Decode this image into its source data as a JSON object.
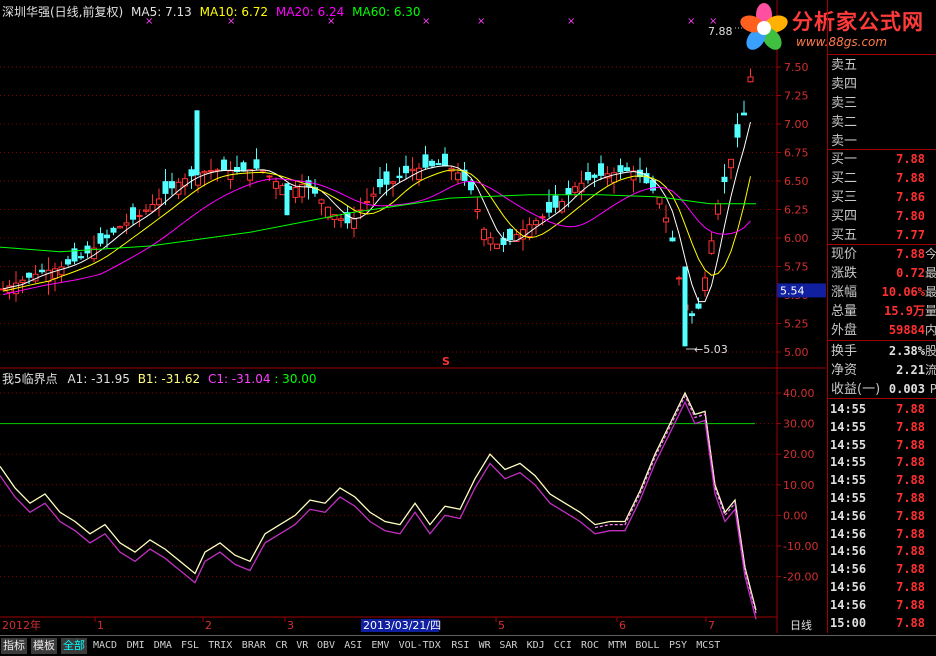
{
  "header": {
    "stock": "深圳华强(日线,前复权)",
    "ma5": "MA5: 7.13",
    "ma10": "MA10: 6.72",
    "ma20": "MA20: 6.24",
    "ma60": "MA60: 6.30"
  },
  "indicator": {
    "name": "我5临界点",
    "a1": "A1: -31.95",
    "b1": "B1: -31.62",
    "c1": "C1: -31.04",
    "level": ": 30.00"
  },
  "price_axis": [
    "7.50",
    "7.25",
    "7.00",
    "6.75",
    "6.50",
    "6.25",
    "6.00",
    "5.75",
    "5.50",
    "5.25",
    "5.00"
  ],
  "price_highlight": "5.54",
  "high_label": "7.88",
  "low_label": "←5.03",
  "ind_axis": [
    "40.00",
    "30.00",
    "20.00",
    "10.00",
    "0.00",
    "-10.00",
    "-20.00"
  ],
  "date_axis": {
    "year": "2012年",
    "ticks": [
      "1",
      "2",
      "3",
      "5",
      "6",
      "7"
    ],
    "selected": "2013/03/21/四",
    "period": "日线"
  },
  "s_marker": "S",
  "logo": {
    "title": "分析家公式网",
    "url": "www.88gs.com"
  },
  "quote": {
    "asks": [
      {
        "label": "卖五",
        "price": "",
        "vol": ""
      },
      {
        "label": "卖四",
        "price": "",
        "vol": ""
      },
      {
        "label": "卖三",
        "price": "",
        "vol": ""
      },
      {
        "label": "卖二",
        "price": "",
        "vol": ""
      },
      {
        "label": "卖一",
        "price": "",
        "vol": ""
      }
    ],
    "bids": [
      {
        "label": "买一",
        "price": "7.88"
      },
      {
        "label": "买二",
        "price": "7.88"
      },
      {
        "label": "买三",
        "price": "7.86"
      },
      {
        "label": "买四",
        "price": "7.80"
      },
      {
        "label": "买五",
        "price": "7.77"
      }
    ],
    "stats": [
      {
        "label": "现价",
        "value": "7.88",
        "ext": "今"
      },
      {
        "label": "涨跌",
        "value": "0.72",
        "ext": "最"
      },
      {
        "label": "涨幅",
        "value": "10.06%",
        "ext": "最"
      },
      {
        "label": "总量",
        "value": "15.9万",
        "ext": "量"
      },
      {
        "label": "外盘",
        "value": "59884",
        "ext": "内"
      }
    ],
    "stats2": [
      {
        "label": "换手",
        "value": "2.38%",
        "ext": "股"
      },
      {
        "label": "净资",
        "value": "2.21",
        "ext": "流"
      },
      {
        "label": "收益(一)",
        "value": "0.003",
        "ext": "P"
      }
    ],
    "ticks": [
      {
        "time": "14:55",
        "price": "7.88"
      },
      {
        "time": "14:55",
        "price": "7.88"
      },
      {
        "time": "14:55",
        "price": "7.88"
      },
      {
        "time": "14:55",
        "price": "7.88"
      },
      {
        "time": "14:55",
        "price": "7.88"
      },
      {
        "time": "14:55",
        "price": "7.88"
      },
      {
        "time": "14:56",
        "price": "7.88"
      },
      {
        "time": "14:56",
        "price": "7.88"
      },
      {
        "time": "14:56",
        "price": "7.88"
      },
      {
        "time": "14:56",
        "price": "7.88"
      },
      {
        "time": "14:56",
        "price": "7.88"
      },
      {
        "time": "14:56",
        "price": "7.88"
      },
      {
        "time": "15:00",
        "price": "7.88"
      }
    ]
  },
  "tabs": {
    "buttons": [
      "指标",
      "模板",
      "全部"
    ],
    "indicators": [
      "MACD",
      "DMI",
      "DMA",
      "FSL",
      "TRIX",
      "BRAR",
      "CR",
      "VR",
      "OBV",
      "ASI",
      "EMV",
      "VOL-TDX",
      "RSI",
      "WR",
      "SAR",
      "KDJ",
      "CCI",
      "ROC",
      "MTM",
      "BOLL",
      "PSY",
      "MCST"
    ]
  },
  "colors": {
    "up": "#ff3232",
    "down": "#54ffff",
    "ma5": "#ffffff",
    "ma10": "#ffff00",
    "ma20": "#ff00ff",
    "ma60": "#00ff00"
  }
}
